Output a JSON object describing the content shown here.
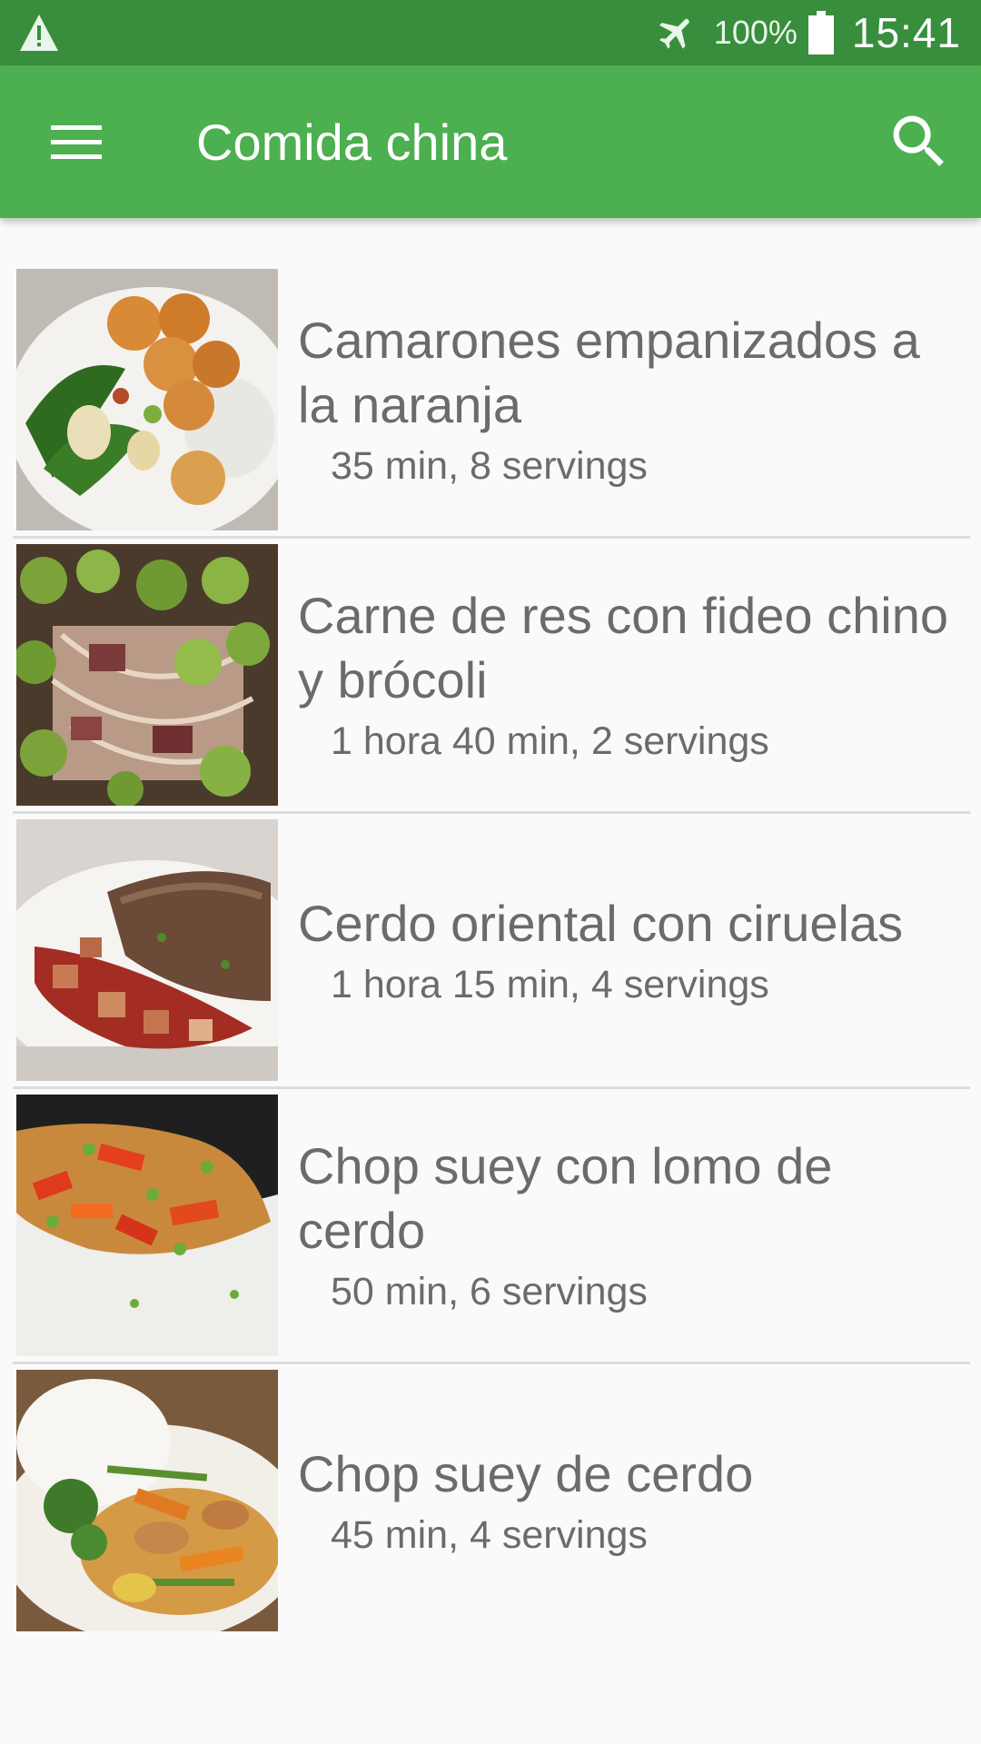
{
  "status_bar": {
    "battery": "100%",
    "time": "15:41",
    "icons": [
      "warning-icon",
      "airplane-mode-icon",
      "battery-icon"
    ]
  },
  "app_bar": {
    "title": "Comida china",
    "icons": [
      "menu-icon",
      "search-icon"
    ],
    "color": "#4caf50"
  },
  "recipes": [
    {
      "name": "Camarones empanizados a la naranja",
      "meta": "35 min, 8 servings"
    },
    {
      "name": "Carne de res con fideo chino y brócoli",
      "meta": "1 hora 40 min, 2 servings"
    },
    {
      "name": "Cerdo oriental con ciruelas",
      "meta": "1 hora 15 min, 4 servings"
    },
    {
      "name": "Chop suey con lomo de cerdo",
      "meta": "50 min, 6 servings"
    },
    {
      "name": "Chop suey de cerdo",
      "meta": "45 min, 4 servings"
    }
  ]
}
